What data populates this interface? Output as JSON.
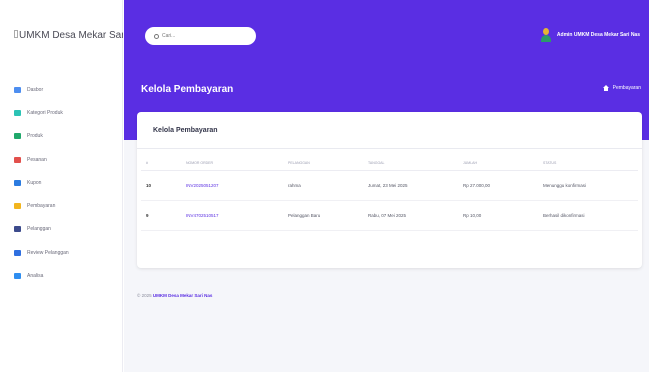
{
  "app": {
    "brand": "UMKM Desa Mekar Sari"
  },
  "sidebar": {
    "items": [
      {
        "label": "Dasbor",
        "color": "#4d8ef0"
      },
      {
        "label": "Kategori Produk",
        "color": "#2cc3b5"
      },
      {
        "label": "Produk",
        "color": "#20a86b"
      },
      {
        "label": "Pesanan",
        "color": "#e2504c"
      },
      {
        "label": "Kupon",
        "color": "#2b7be0"
      },
      {
        "label": "Pembayaran",
        "color": "#f2b51e"
      },
      {
        "label": "Pelanggan",
        "color": "#3c4b8c"
      },
      {
        "label": "Review Pelanggan",
        "color": "#2f6fe0"
      },
      {
        "label": "Analisa",
        "color": "#2f8ef0"
      }
    ]
  },
  "header": {
    "search_placeholder": "Cari...",
    "user_name": "Admin UMKM Desa Mekar Sari Nas"
  },
  "page": {
    "title": "Kelola Pembayaran",
    "breadcrumb": "Pembayaran"
  },
  "card": {
    "title": "Kelola Pembayaran",
    "columns": [
      "#",
      "Nomor Order",
      "Pelanggan",
      "Tanggal",
      "Jumlah",
      "Status"
    ],
    "rows": [
      {
        "no": "10",
        "order": "INV2025051207",
        "customer": "rahma",
        "date": "Jumat, 23 Mei 2025",
        "amount": "Rp 27.000,00",
        "status": "Menunggu konfirmasi"
      },
      {
        "no": "9",
        "order": "INV4702510517",
        "customer": "Pelanggan Baru",
        "date": "Rabu, 07 Mei 2025",
        "amount": "Rp 10,00",
        "status": "Berhasil dikonfirmasi"
      }
    ]
  },
  "footer": {
    "prefix": "© 2025",
    "name": "UMKM Desa Mekar Sari Nas"
  },
  "colors": {
    "primary": "#5a2ee3",
    "background": "#f5f6fa"
  }
}
